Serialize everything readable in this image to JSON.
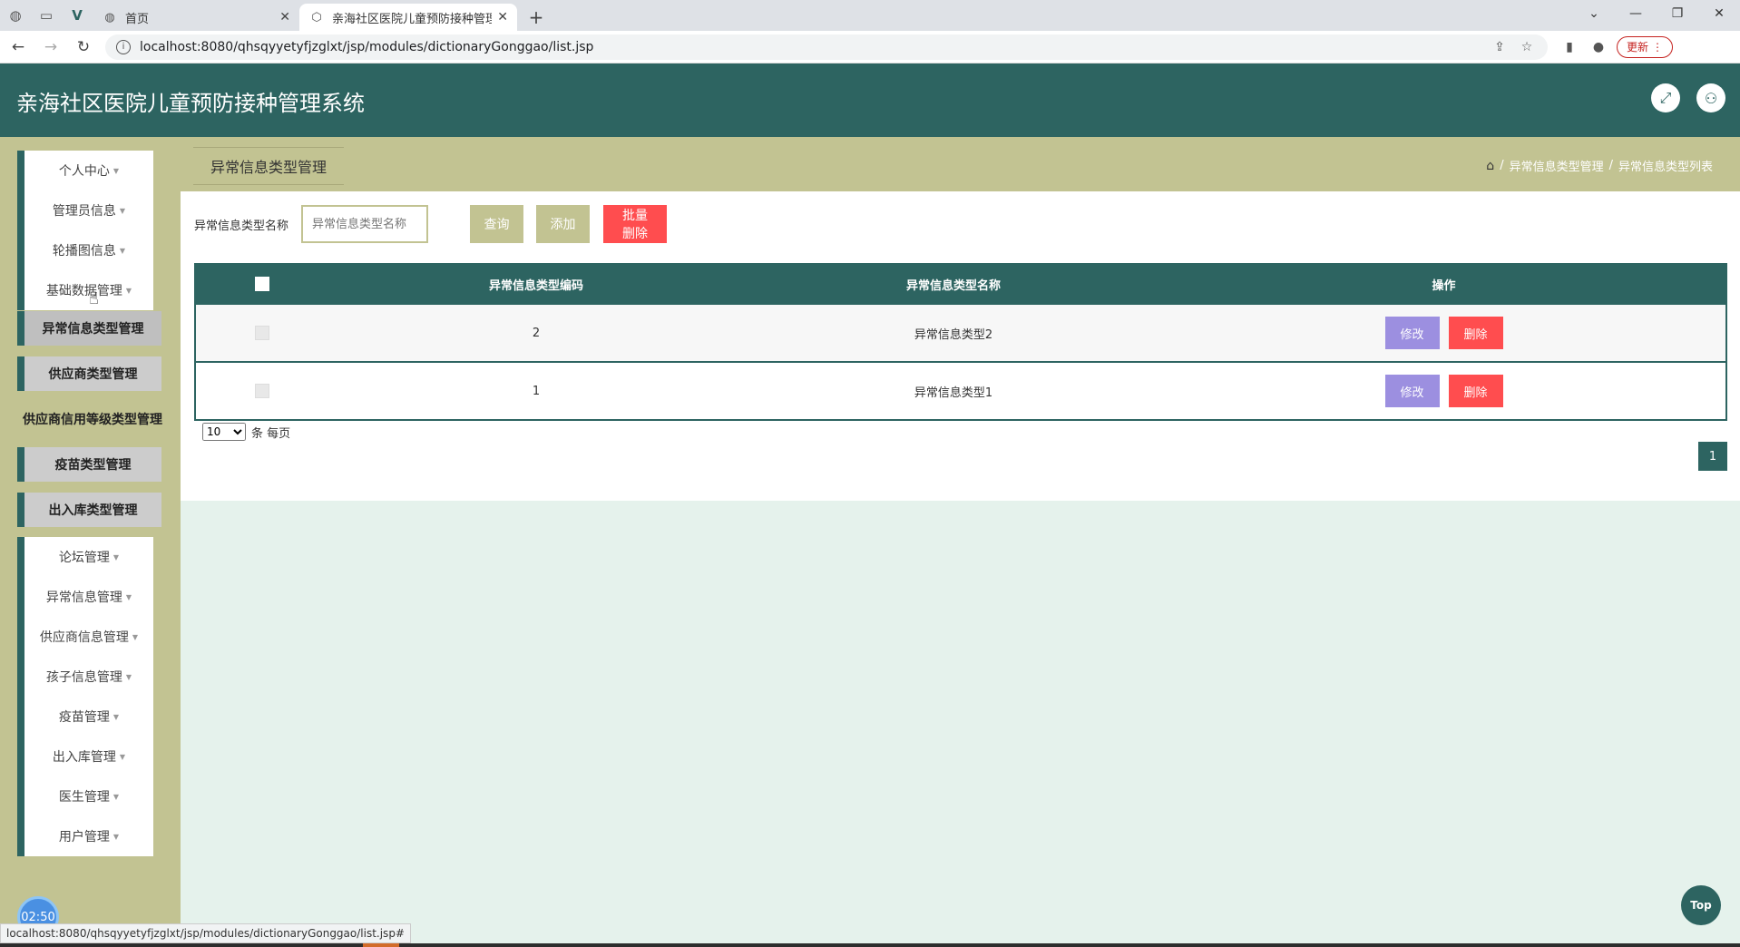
{
  "browser": {
    "tabs": [
      {
        "title": "首页",
        "active": false
      },
      {
        "title": "亲海社区医院儿童预防接种管理系统",
        "active": true
      }
    ],
    "url": "localhost:8080/qhsqyyetyfjzglxt/jsp/modules/dictionaryGonggao/list.jsp",
    "update_label": "更新",
    "status_url": "localhost:8080/qhsqyyetyfjzglxt/jsp/modules/dictionaryGonggao/list.jsp#"
  },
  "header": {
    "title": "亲海社区医院儿童预防接种管理系统"
  },
  "sidebar": {
    "top_items": [
      {
        "label": "个人中心"
      },
      {
        "label": "管理员信息"
      },
      {
        "label": "轮播图信息"
      },
      {
        "label": "基础数据管理"
      }
    ],
    "sub_items": [
      {
        "label": "异常信息类型管理"
      },
      {
        "label": "供应商类型管理"
      },
      {
        "label": "供应商信用等级类型管理"
      },
      {
        "label": "疫苗类型管理"
      },
      {
        "label": "出入库类型管理"
      }
    ],
    "bottom_items": [
      {
        "label": "论坛管理"
      },
      {
        "label": "异常信息管理"
      },
      {
        "label": "供应商信息管理"
      },
      {
        "label": "孩子信息管理"
      },
      {
        "label": "疫苗管理"
      },
      {
        "label": "出入库管理"
      },
      {
        "label": "医生管理"
      },
      {
        "label": "用户管理"
      }
    ]
  },
  "page": {
    "label": "异常信息类型管理",
    "breadcrumb": [
      "异常信息类型管理",
      "异常信息类型列表"
    ]
  },
  "search": {
    "label": "异常信息类型名称",
    "placeholder": "异常信息类型名称",
    "query_label": "查询",
    "add_label": "添加",
    "batch_delete_label": "批量删除"
  },
  "table": {
    "headers": {
      "code": "异常信息类型编码",
      "name": "异常信息类型名称",
      "op": "操作"
    },
    "rows": [
      {
        "code": "2",
        "name": "异常信息类型2",
        "edit": "修改",
        "delete": "删除"
      },
      {
        "code": "1",
        "name": "异常信息类型1",
        "edit": "修改",
        "delete": "删除"
      }
    ]
  },
  "pager": {
    "page_size": "10",
    "per_page_label": "条 每页",
    "current_page": "1"
  },
  "top_label": "Top",
  "timer": "02:50",
  "colors": {
    "primary": "#2d6461",
    "accent": "#c2c392",
    "danger": "#ff4d4f",
    "edit": "#9c8fe0"
  }
}
